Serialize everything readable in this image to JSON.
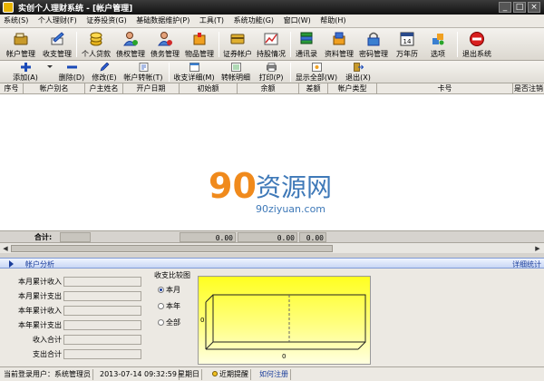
{
  "window": {
    "title": "实创个人理财系统 - [帐户管理]",
    "controls": [
      "_",
      "□",
      "×"
    ]
  },
  "menu": [
    "系统(S)",
    "个人理财(F)",
    "证券投资(G)",
    "基础数据维护(P)",
    "工具(T)",
    "系统功能(G)",
    "窗口(W)",
    "帮助(H)"
  ],
  "big_toolbar": [
    {
      "label": "帐户管理",
      "icon": "wallet-icon"
    },
    {
      "label": "收支管理",
      "icon": "pen-icon"
    },
    {
      "label": "个人贷款",
      "icon": "coins-icon"
    },
    {
      "label": "债权管理",
      "icon": "person-plus-icon"
    },
    {
      "label": "债务管理",
      "icon": "person-minus-icon"
    },
    {
      "label": "物品管理",
      "icon": "box-icon"
    },
    {
      "label": "证券帐户",
      "icon": "card-icon"
    },
    {
      "label": "持股情况",
      "icon": "chart-icon"
    },
    {
      "label": "通讯录",
      "icon": "book-icon"
    },
    {
      "label": "资料管理",
      "icon": "docs-icon"
    },
    {
      "label": "密码管理",
      "icon": "lock-icon"
    },
    {
      "label": "万年历",
      "icon": "calendar-icon"
    },
    {
      "label": "选项",
      "icon": "options-icon"
    },
    {
      "label": "退出系统",
      "icon": "stop-icon"
    }
  ],
  "small_toolbar": [
    {
      "label": "添加(A)",
      "icon": "plus-icon"
    },
    {
      "label": "删除(D)",
      "icon": "minus-icon"
    },
    {
      "label": "修改(E)",
      "icon": "edit-icon"
    },
    {
      "label": "帐户转帐(T)",
      "icon": "transfer-icon"
    },
    {
      "label": "收支详细(M)",
      "icon": "detail-icon"
    },
    {
      "label": "转帐明细",
      "icon": "list-icon"
    },
    {
      "label": "打印(P)",
      "icon": "print-icon"
    },
    {
      "label": "显示全部(W)",
      "icon": "show-all-icon"
    },
    {
      "label": "退出(X)",
      "icon": "exit-icon"
    }
  ],
  "table": {
    "columns": [
      "序号",
      "帐户别名",
      "户主姓名",
      "开户日期",
      "初始额",
      "余额",
      "差额",
      "帐户类型",
      "卡号",
      "是否注销"
    ],
    "rows": []
  },
  "watermark": {
    "brand": "资源网",
    "digits": "90",
    "domain": "90ziyuan.com"
  },
  "totals": {
    "label": "合计:",
    "values": [
      "0.00",
      "0.00",
      "0.00"
    ]
  },
  "analysis": {
    "label": "帐户分析",
    "detail_link": "详细统计"
  },
  "stats": [
    {
      "label": "本月累计收入",
      "value": ""
    },
    {
      "label": "本月累计支出",
      "value": ""
    },
    {
      "label": "本年累计收入",
      "value": ""
    },
    {
      "label": "本年累计支出",
      "value": ""
    },
    {
      "label": "收入合计",
      "value": ""
    },
    {
      "label": "支出合计",
      "value": ""
    }
  ],
  "compare": {
    "legend_title": "收支比较图",
    "options": [
      "本月",
      "本年",
      "全部"
    ],
    "selected": 0
  },
  "chart_data": {
    "type": "bar",
    "categories": [],
    "series": [],
    "y_tick_label": "0",
    "x_tick_label": "0",
    "background": [
      "#ffff20",
      "#ffffe0"
    ]
  },
  "status": {
    "login_user": "当前登录用户：系统管理员",
    "datetime": "2013-07-14  09:32:59",
    "weekday": "星期日",
    "reminder": "近期提醒",
    "register": "如何注册"
  },
  "colors": {
    "accent": "#1a3d9b",
    "watermark_orange": "#f08a1c",
    "watermark_blue": "#3f79b8"
  }
}
